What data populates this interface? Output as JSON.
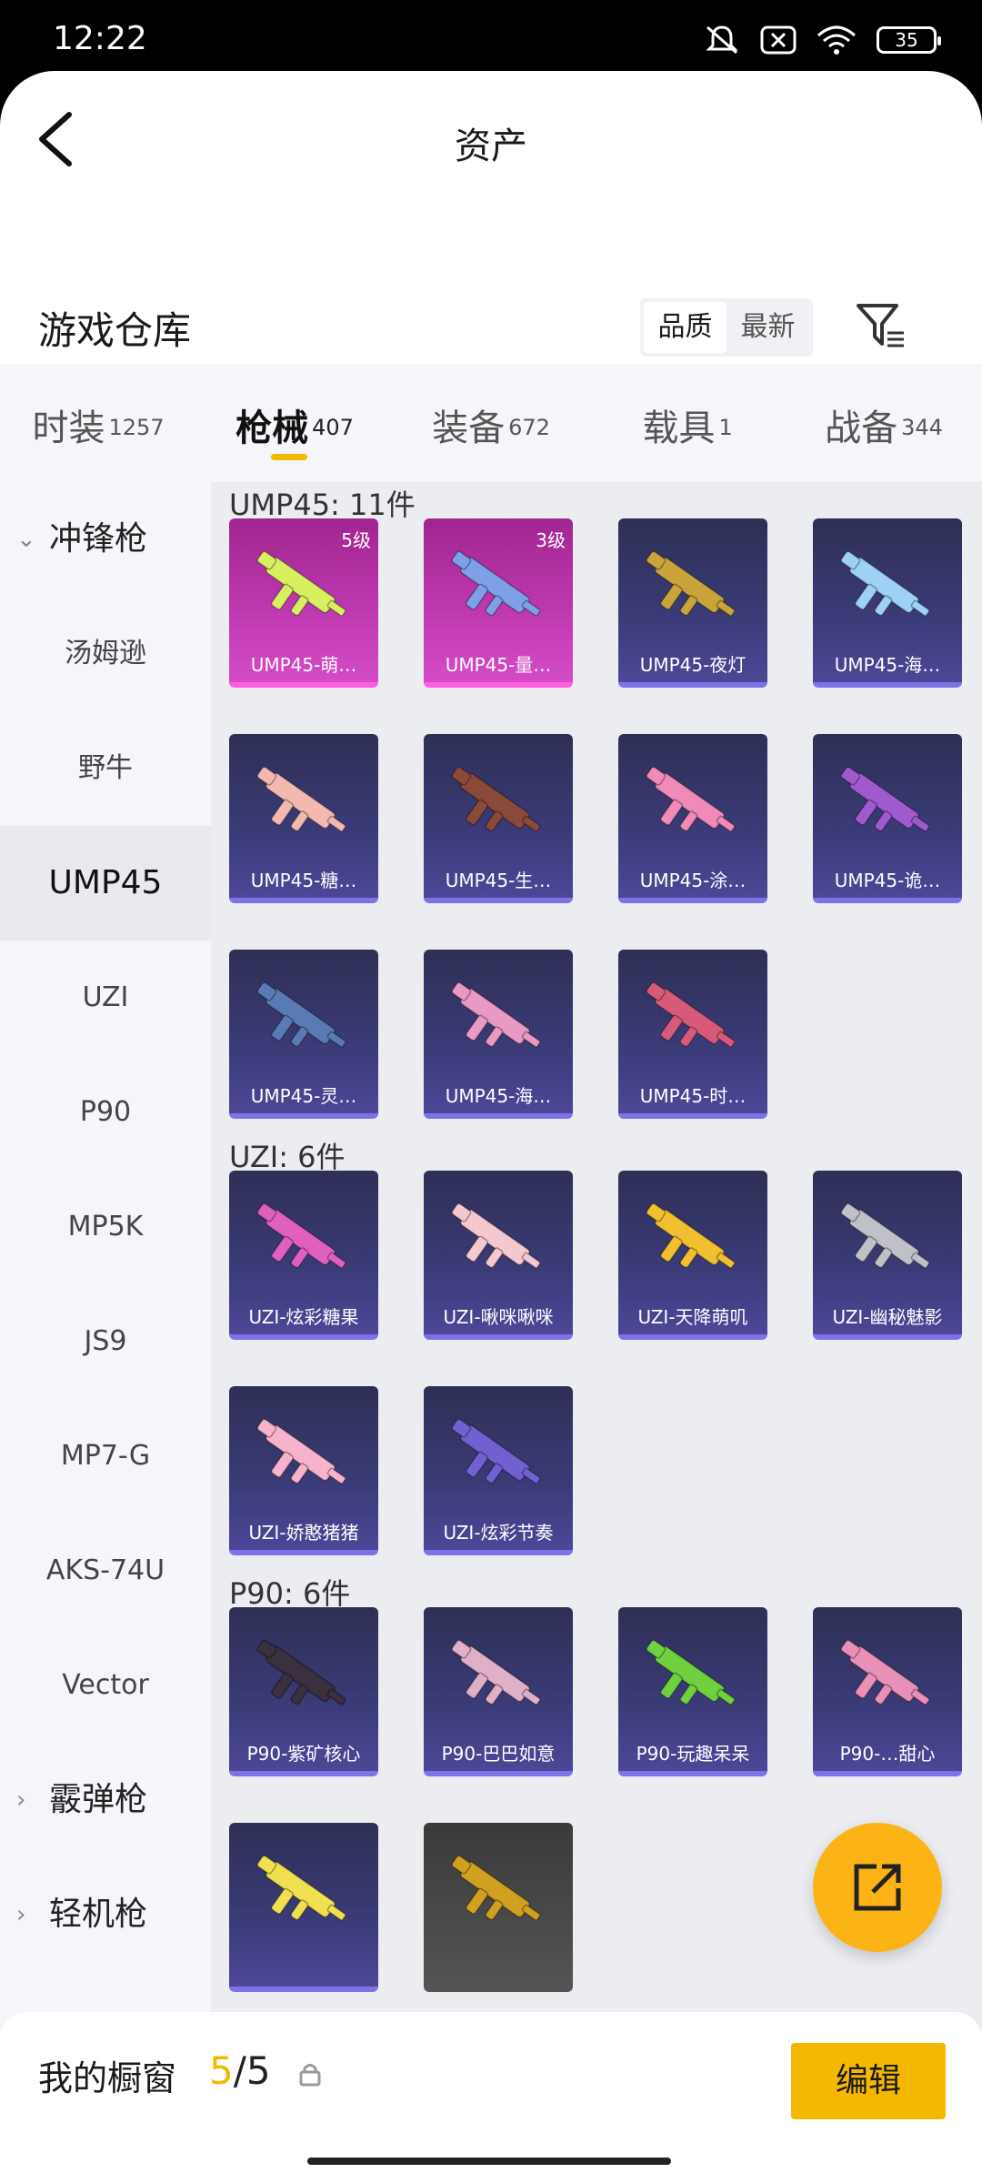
{
  "status_bar": {
    "time": "12:22",
    "battery": "35"
  },
  "header": {
    "title": "资产"
  },
  "section": {
    "title": "游戏仓库",
    "sort_options": [
      "品质",
      "最新"
    ],
    "active_sort": "品质"
  },
  "tabs": [
    {
      "label": "时装",
      "count": "1257"
    },
    {
      "label": "枪械",
      "count": "407",
      "active": true
    },
    {
      "label": "装备",
      "count": "672"
    },
    {
      "label": "载具",
      "count": "1"
    },
    {
      "label": "战备",
      "count": "344"
    }
  ],
  "sidebar": [
    {
      "label": "冲锋枪",
      "type": "group",
      "chev": "⌄"
    },
    {
      "label": "汤姆逊"
    },
    {
      "label": "野牛"
    },
    {
      "label": "UMP45",
      "active": true
    },
    {
      "label": "UZI"
    },
    {
      "label": "P90"
    },
    {
      "label": "MP5K"
    },
    {
      "label": "JS9"
    },
    {
      "label": "MP7-G"
    },
    {
      "label": "AKS-74U"
    },
    {
      "label": "Vector"
    },
    {
      "label": "霰弹枪",
      "type": "group",
      "chev": "›"
    },
    {
      "label": "轻机枪",
      "type": "group",
      "chev": "›"
    }
  ],
  "groups": [
    {
      "title": "UMP45: 11件",
      "items": [
        {
          "name": "UMP45-萌…",
          "level": "5级",
          "rarity": "pink",
          "color": "#d8f060"
        },
        {
          "name": "UMP45-量…",
          "level": "3级",
          "rarity": "pink",
          "color": "#7da0e8"
        },
        {
          "name": "UMP45-夜灯",
          "rarity": "purple",
          "color": "#c9a43a"
        },
        {
          "name": "UMP45-海…",
          "rarity": "purple",
          "color": "#9fd0f5"
        },
        {
          "name": "UMP45-糖…",
          "rarity": "purple",
          "color": "#f3b9b0"
        },
        {
          "name": "UMP45-生…",
          "rarity": "purple",
          "color": "#8a4a3a"
        },
        {
          "name": "UMP45-涂…",
          "rarity": "purple",
          "color": "#f08ab8"
        },
        {
          "name": "UMP45-诡…",
          "rarity": "purple",
          "color": "#a05ad0"
        },
        {
          "name": "UMP45-灵…",
          "rarity": "purple",
          "color": "#5a7ab5"
        },
        {
          "name": "UMP45-海…",
          "rarity": "purple",
          "color": "#e89ac5"
        },
        {
          "name": "UMP45-时…",
          "rarity": "purple",
          "color": "#d85a7a"
        }
      ]
    },
    {
      "title": "UZI: 6件",
      "items": [
        {
          "name": "UZI-炫彩糖果",
          "rarity": "purple",
          "color": "#e060c0"
        },
        {
          "name": "UZI-啾咪啾咪",
          "rarity": "purple",
          "color": "#f5c8d0"
        },
        {
          "name": "UZI-天降萌叽",
          "rarity": "purple",
          "color": "#f0c030"
        },
        {
          "name": "UZI-幽秘魅影",
          "rarity": "purple",
          "color": "#c0c0c8"
        },
        {
          "name": "UZI-娇憨猪猪",
          "rarity": "purple",
          "color": "#f7b3cc"
        },
        {
          "name": "UZI-炫彩节奏",
          "rarity": "purple",
          "color": "#7060d0"
        }
      ]
    },
    {
      "title": "P90: 6件",
      "items": [
        {
          "name": "P90-紫矿核心",
          "rarity": "purple",
          "color": "#3a3040"
        },
        {
          "name": "P90-巴巴如意",
          "rarity": "purple",
          "color": "#e0b0c8"
        },
        {
          "name": "P90-玩趣呆呆",
          "rarity": "purple",
          "color": "#70d040"
        },
        {
          "name": "P90-…甜心",
          "rarity": "purple",
          "color": "#e890b8"
        },
        {
          "name": "",
          "rarity": "purple",
          "color": "#f0e050"
        },
        {
          "name": "",
          "rarity": "grey",
          "color": "#d0a020"
        }
      ]
    }
  ],
  "bottom_bar": {
    "label": "我的橱窗",
    "count_current": "5",
    "count_total": "/5",
    "edit_label": "编辑"
  }
}
